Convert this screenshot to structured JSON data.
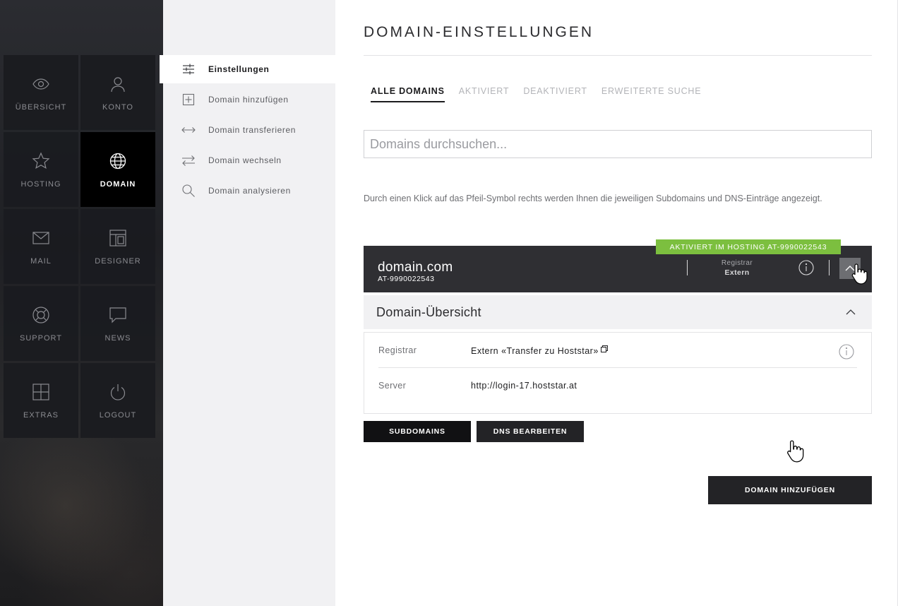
{
  "leftnav": {
    "tiles": [
      {
        "label": "ÜBERSICHT",
        "icon": "eye-icon"
      },
      {
        "label": "KONTO",
        "icon": "user-icon"
      },
      {
        "label": "HOSTING",
        "icon": "star-icon"
      },
      {
        "label": "DOMAIN",
        "icon": "globe-icon",
        "active": true
      },
      {
        "label": "MAIL",
        "icon": "envelope-icon"
      },
      {
        "label": "DESIGNER",
        "icon": "layout-icon"
      },
      {
        "label": "SUPPORT",
        "icon": "lifebuoy-icon"
      },
      {
        "label": "NEWS",
        "icon": "speech-bubble-icon"
      },
      {
        "label": "EXTRAS",
        "icon": "plus-box-icon"
      },
      {
        "label": "LOGOUT",
        "icon": "power-icon"
      }
    ]
  },
  "submenu": {
    "items": [
      {
        "label": "Einstellungen",
        "icon": "sliders-icon",
        "active": true
      },
      {
        "label": "Domain hinzufügen",
        "icon": "plus-square-icon"
      },
      {
        "label": "Domain transferieren",
        "icon": "double-arrow-icon"
      },
      {
        "label": "Domain wechseln",
        "icon": "swap-arrows-icon"
      },
      {
        "label": "Domain analysieren",
        "icon": "magnifier-icon"
      }
    ]
  },
  "main": {
    "title": "DOMAIN-EINSTELLUNGEN",
    "tabs": [
      {
        "label": "ALLE DOMAINS",
        "active": true
      },
      {
        "label": "AKTIVIERT"
      },
      {
        "label": "DEAKTIVIERT"
      },
      {
        "label": "ERWEITERTE SUCHE"
      }
    ],
    "search": {
      "placeholder": "Domains durchsuchen..."
    },
    "info_text": "Durch einen Klick auf das Pfeil-Symbol rechts werden Ihnen die jeweiligen Subdomains und DNS-Einträge angezeigt.",
    "domain": {
      "name": "domain.com",
      "id": "AT-9990022543",
      "badge": "AKTIVIERT IM HOSTING AT-9990022543",
      "registrar_label": "Registrar",
      "registrar_value": "Extern"
    },
    "overview": {
      "title": "Domain-Übersicht",
      "rows": [
        {
          "key": "Registrar",
          "value": "Extern «Transfer zu Hoststar»"
        },
        {
          "key": "Server",
          "value": "http://login-17.hoststar.at"
        }
      ]
    },
    "buttons": {
      "subdomains": "SUBDOMAINS",
      "dns": "DNS BEARBEITEN",
      "add_domain": "DOMAIN HINZUFÜGEN"
    }
  },
  "colors": {
    "accent_green": "#7cbf3f",
    "dark": "#2f2f33",
    "sidebar_bg": "#f1f1f3"
  }
}
